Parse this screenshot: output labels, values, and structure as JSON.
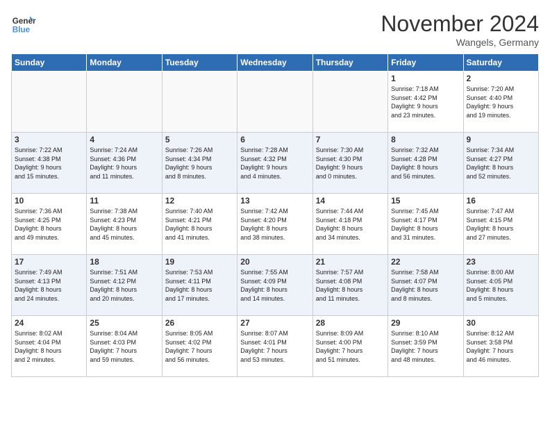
{
  "logo": {
    "line1": "General",
    "line2": "Blue"
  },
  "title": "November 2024",
  "location": "Wangels, Germany",
  "days_of_week": [
    "Sunday",
    "Monday",
    "Tuesday",
    "Wednesday",
    "Thursday",
    "Friday",
    "Saturday"
  ],
  "weeks": [
    [
      {
        "day": "",
        "info": ""
      },
      {
        "day": "",
        "info": ""
      },
      {
        "day": "",
        "info": ""
      },
      {
        "day": "",
        "info": ""
      },
      {
        "day": "",
        "info": ""
      },
      {
        "day": "1",
        "info": "Sunrise: 7:18 AM\nSunset: 4:42 PM\nDaylight: 9 hours\nand 23 minutes."
      },
      {
        "day": "2",
        "info": "Sunrise: 7:20 AM\nSunset: 4:40 PM\nDaylight: 9 hours\nand 19 minutes."
      }
    ],
    [
      {
        "day": "3",
        "info": "Sunrise: 7:22 AM\nSunset: 4:38 PM\nDaylight: 9 hours\nand 15 minutes."
      },
      {
        "day": "4",
        "info": "Sunrise: 7:24 AM\nSunset: 4:36 PM\nDaylight: 9 hours\nand 11 minutes."
      },
      {
        "day": "5",
        "info": "Sunrise: 7:26 AM\nSunset: 4:34 PM\nDaylight: 9 hours\nand 8 minutes."
      },
      {
        "day": "6",
        "info": "Sunrise: 7:28 AM\nSunset: 4:32 PM\nDaylight: 9 hours\nand 4 minutes."
      },
      {
        "day": "7",
        "info": "Sunrise: 7:30 AM\nSunset: 4:30 PM\nDaylight: 9 hours\nand 0 minutes."
      },
      {
        "day": "8",
        "info": "Sunrise: 7:32 AM\nSunset: 4:28 PM\nDaylight: 8 hours\nand 56 minutes."
      },
      {
        "day": "9",
        "info": "Sunrise: 7:34 AM\nSunset: 4:27 PM\nDaylight: 8 hours\nand 52 minutes."
      }
    ],
    [
      {
        "day": "10",
        "info": "Sunrise: 7:36 AM\nSunset: 4:25 PM\nDaylight: 8 hours\nand 49 minutes."
      },
      {
        "day": "11",
        "info": "Sunrise: 7:38 AM\nSunset: 4:23 PM\nDaylight: 8 hours\nand 45 minutes."
      },
      {
        "day": "12",
        "info": "Sunrise: 7:40 AM\nSunset: 4:21 PM\nDaylight: 8 hours\nand 41 minutes."
      },
      {
        "day": "13",
        "info": "Sunrise: 7:42 AM\nSunset: 4:20 PM\nDaylight: 8 hours\nand 38 minutes."
      },
      {
        "day": "14",
        "info": "Sunrise: 7:44 AM\nSunset: 4:18 PM\nDaylight: 8 hours\nand 34 minutes."
      },
      {
        "day": "15",
        "info": "Sunrise: 7:45 AM\nSunset: 4:17 PM\nDaylight: 8 hours\nand 31 minutes."
      },
      {
        "day": "16",
        "info": "Sunrise: 7:47 AM\nSunset: 4:15 PM\nDaylight: 8 hours\nand 27 minutes."
      }
    ],
    [
      {
        "day": "17",
        "info": "Sunrise: 7:49 AM\nSunset: 4:13 PM\nDaylight: 8 hours\nand 24 minutes."
      },
      {
        "day": "18",
        "info": "Sunrise: 7:51 AM\nSunset: 4:12 PM\nDaylight: 8 hours\nand 20 minutes."
      },
      {
        "day": "19",
        "info": "Sunrise: 7:53 AM\nSunset: 4:11 PM\nDaylight: 8 hours\nand 17 minutes."
      },
      {
        "day": "20",
        "info": "Sunrise: 7:55 AM\nSunset: 4:09 PM\nDaylight: 8 hours\nand 14 minutes."
      },
      {
        "day": "21",
        "info": "Sunrise: 7:57 AM\nSunset: 4:08 PM\nDaylight: 8 hours\nand 11 minutes."
      },
      {
        "day": "22",
        "info": "Sunrise: 7:58 AM\nSunset: 4:07 PM\nDaylight: 8 hours\nand 8 minutes."
      },
      {
        "day": "23",
        "info": "Sunrise: 8:00 AM\nSunset: 4:05 PM\nDaylight: 8 hours\nand 5 minutes."
      }
    ],
    [
      {
        "day": "24",
        "info": "Sunrise: 8:02 AM\nSunset: 4:04 PM\nDaylight: 8 hours\nand 2 minutes."
      },
      {
        "day": "25",
        "info": "Sunrise: 8:04 AM\nSunset: 4:03 PM\nDaylight: 7 hours\nand 59 minutes."
      },
      {
        "day": "26",
        "info": "Sunrise: 8:05 AM\nSunset: 4:02 PM\nDaylight: 7 hours\nand 56 minutes."
      },
      {
        "day": "27",
        "info": "Sunrise: 8:07 AM\nSunset: 4:01 PM\nDaylight: 7 hours\nand 53 minutes."
      },
      {
        "day": "28",
        "info": "Sunrise: 8:09 AM\nSunset: 4:00 PM\nDaylight: 7 hours\nand 51 minutes."
      },
      {
        "day": "29",
        "info": "Sunrise: 8:10 AM\nSunset: 3:59 PM\nDaylight: 7 hours\nand 48 minutes."
      },
      {
        "day": "30",
        "info": "Sunrise: 8:12 AM\nSunset: 3:58 PM\nDaylight: 7 hours\nand 46 minutes."
      }
    ]
  ]
}
